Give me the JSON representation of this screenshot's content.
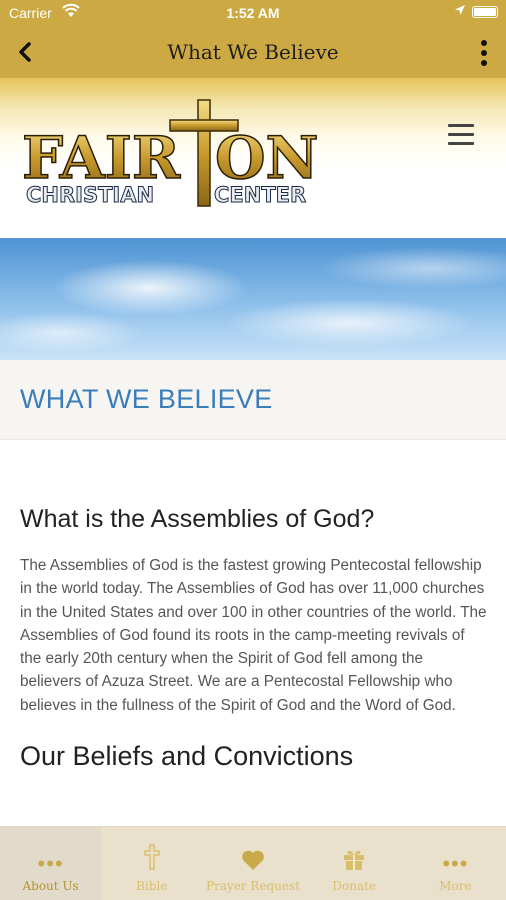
{
  "status_bar": {
    "carrier": "Carrier",
    "time": "1:52 AM"
  },
  "nav_bar": {
    "title": "What We Believe"
  },
  "logo": {
    "line1": "FAIRTON",
    "line2": "CHRISTIAN CENTER"
  },
  "page": {
    "heading": "WHAT WE BELIEVE",
    "section_title": "What is the Assemblies of God?",
    "paragraph": "The Assemblies of God is the fastest growing Pentecostal fellowship in the world today. The Assemblies of God has over 11,000 churches in the United States and over 100 in other countries of the world. The Assemblies of God found its roots in the camp-meeting revivals of the early 20th century when the Spirit of God fell among the believers of Azuza Street. We are a Pentecostal Fellowship who believes in the fullness of the Spirit of God and the Word of God.",
    "next_section_title": "Our Beliefs and Convictions"
  },
  "tabs": [
    {
      "label": "About Us",
      "icon": "dots-icon",
      "active": true
    },
    {
      "label": "Bible",
      "icon": "cross-icon",
      "active": false
    },
    {
      "label": "Prayer Request",
      "icon": "heart-icon",
      "active": false
    },
    {
      "label": "Donate",
      "icon": "gift-icon",
      "active": false
    },
    {
      "label": "More",
      "icon": "dots-icon",
      "active": false
    }
  ],
  "colors": {
    "accent_gold": "#cda944",
    "heading_blue": "#3a7dbb",
    "tab_label": "#d9be6c"
  }
}
